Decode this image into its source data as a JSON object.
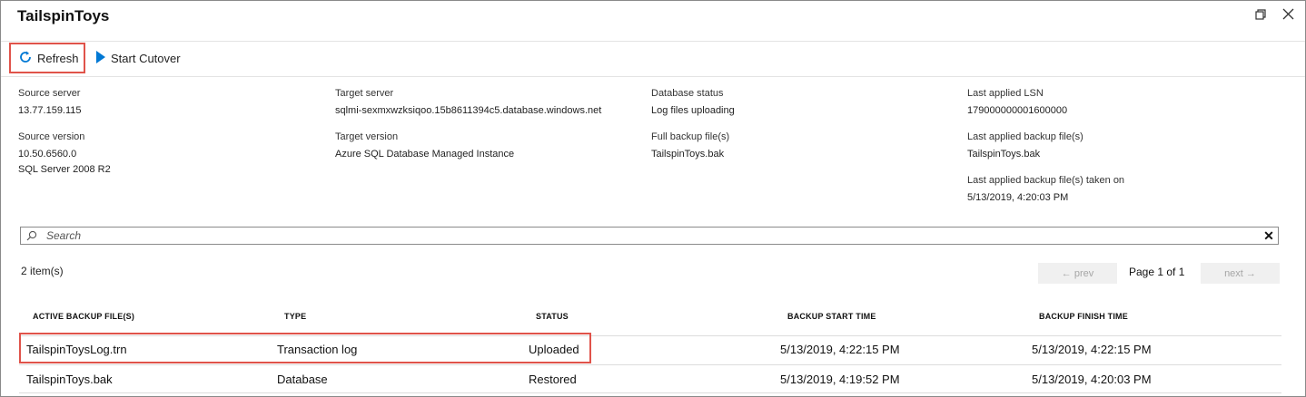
{
  "window": {
    "title": "TailspinToys",
    "restore_icon": "restore-icon",
    "close_icon": "close-icon"
  },
  "toolbar": {
    "refresh_label": "Refresh",
    "refresh_icon": "refresh-icon",
    "cutover_label": "Start Cutover",
    "cutover_icon": "play-icon",
    "accent": "#0078d4",
    "highlight": "#e0534a"
  },
  "info": {
    "source_server_label": "Source server",
    "source_server": "13.77.159.115",
    "source_version_label": "Source version",
    "source_version": "10.50.6560.0",
    "source_version2": "SQL Server 2008 R2",
    "target_server_label": "Target server",
    "target_server": "sqlmi-sexmxwzksiqoo.15b8611394c5.database.windows.net",
    "target_version_label": "Target version",
    "target_version": "Azure SQL Database Managed Instance",
    "db_status_label": "Database status",
    "db_status": "Log files uploading",
    "full_backup_label": "Full backup file(s)",
    "full_backup": "TailspinToys.bak",
    "last_lsn_label": "Last applied LSN",
    "last_lsn": "179000000001600000",
    "last_backup_label": "Last applied backup file(s)",
    "last_backup": "TailspinToys.bak",
    "last_backup_time_label": "Last applied backup file(s) taken on",
    "last_backup_time": "5/13/2019, 4:20:03 PM"
  },
  "search": {
    "placeholder": "Search",
    "icon": "search-icon",
    "clear": "✕"
  },
  "list": {
    "count": "2 item(s)",
    "prev": "← prev",
    "next": "next →",
    "page": "Page 1 of 1",
    "columns": [
      "ACTIVE BACKUP FILE(S)",
      "TYPE",
      "STATUS",
      "BACKUP START TIME",
      "BACKUP FINISH TIME"
    ],
    "rows": [
      {
        "file": "TailspinToysLog.trn",
        "type": "Transaction log",
        "status": "Uploaded",
        "start": "5/13/2019, 4:22:15 PM",
        "finish": "5/13/2019, 4:22:15 PM"
      },
      {
        "file": "TailspinToys.bak",
        "type": "Database",
        "status": "Restored",
        "start": "5/13/2019, 4:19:52 PM",
        "finish": "5/13/2019, 4:20:03 PM"
      }
    ]
  }
}
